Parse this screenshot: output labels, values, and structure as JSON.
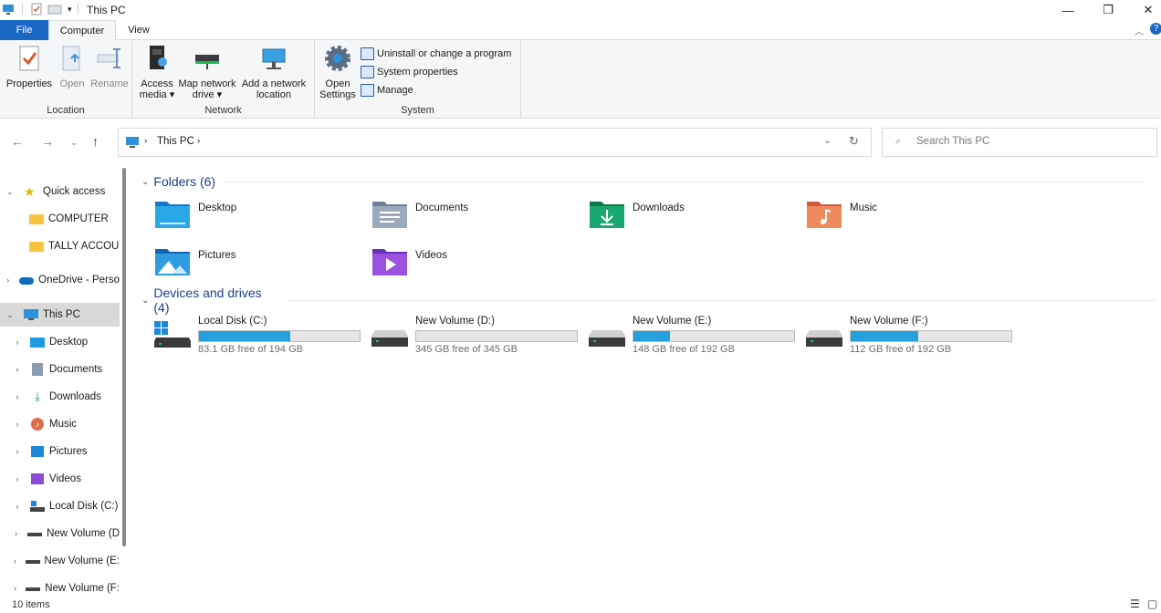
{
  "window": {
    "title": "This PC"
  },
  "tabs": {
    "file": "File",
    "computer": "Computer",
    "view": "View"
  },
  "ribbon": {
    "location": {
      "label": "Location",
      "properties": "Properties",
      "open": "Open",
      "rename": "Rename"
    },
    "network": {
      "label": "Network",
      "access_media_1": "Access",
      "access_media_2": "media ▾",
      "map_drive_1": "Map network",
      "map_drive_2": "drive ▾",
      "add_location_1": "Add a network",
      "add_location_2": "location"
    },
    "system": {
      "label": "System",
      "open_settings_1": "Open",
      "open_settings_2": "Settings",
      "uninstall": "Uninstall or change a program",
      "system_properties": "System properties",
      "manage": "Manage"
    }
  },
  "address": {
    "crumb": "This PC"
  },
  "search": {
    "placeholder": "Search This PC"
  },
  "navpane": {
    "quick_access": "Quick access",
    "computer": "COMPUTER",
    "tally": "TALLY ACCOUN",
    "onedrive": "OneDrive - Perso",
    "this_pc": "This PC",
    "desktop": "Desktop",
    "documents": "Documents",
    "downloads": "Downloads",
    "music": "Music",
    "pictures": "Pictures",
    "videos": "Videos",
    "local_c": "Local Disk (C:)",
    "vol_d": "New Volume (D",
    "vol_e": "New Volume (E:",
    "vol_f": "New Volume (F:"
  },
  "content": {
    "folders_heading": "Folders (6)",
    "folders": [
      "Desktop",
      "Documents",
      "Downloads",
      "Music",
      "Pictures",
      "Videos"
    ],
    "drives_heading": "Devices and drives (4)",
    "drives": [
      {
        "name": "Local Disk (C:)",
        "free": "83.1 GB free of 194 GB",
        "used_fraction": 0.57
      },
      {
        "name": "New Volume (D:)",
        "free": "345 GB free of 345 GB",
        "used_fraction": 0.0
      },
      {
        "name": "New Volume (E:)",
        "free": "148 GB free of 192 GB",
        "used_fraction": 0.23
      },
      {
        "name": "New Volume (F:)",
        "free": "112 GB free of 192 GB",
        "used_fraction": 0.42
      }
    ]
  },
  "status": {
    "items": "10 items"
  },
  "colors": {
    "accent": "#1a67c4",
    "drive_bar": "#26a0da"
  }
}
